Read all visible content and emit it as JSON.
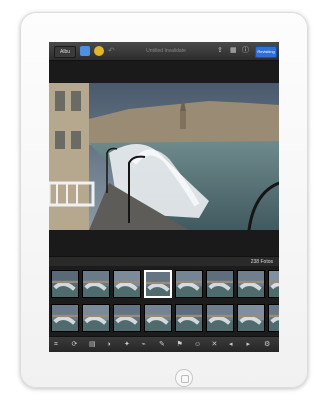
{
  "toolbar": {
    "albums_label": "Albu",
    "title": "Untitled Invalidate",
    "edit_label": "Revisiting",
    "share_icon": "share-icon",
    "grid_icon": "grid-icon",
    "info_icon": "info-icon"
  },
  "filmstrip": {
    "count_label": "238 Fotos",
    "selected_index": 3
  },
  "bottombar": {
    "icons": [
      "crop-icon",
      "rotate-icon",
      "levels-icon",
      "color-icon",
      "effects-icon",
      "brush-icon",
      "tag-icon",
      "flag-icon",
      "person-icon",
      "delete-icon",
      "back-icon",
      "forward-icon",
      "gear-icon"
    ]
  },
  "colors": {
    "accent": "#2f6fd6",
    "yellow": "#e1b52a",
    "blue": "#4d8fe0"
  }
}
